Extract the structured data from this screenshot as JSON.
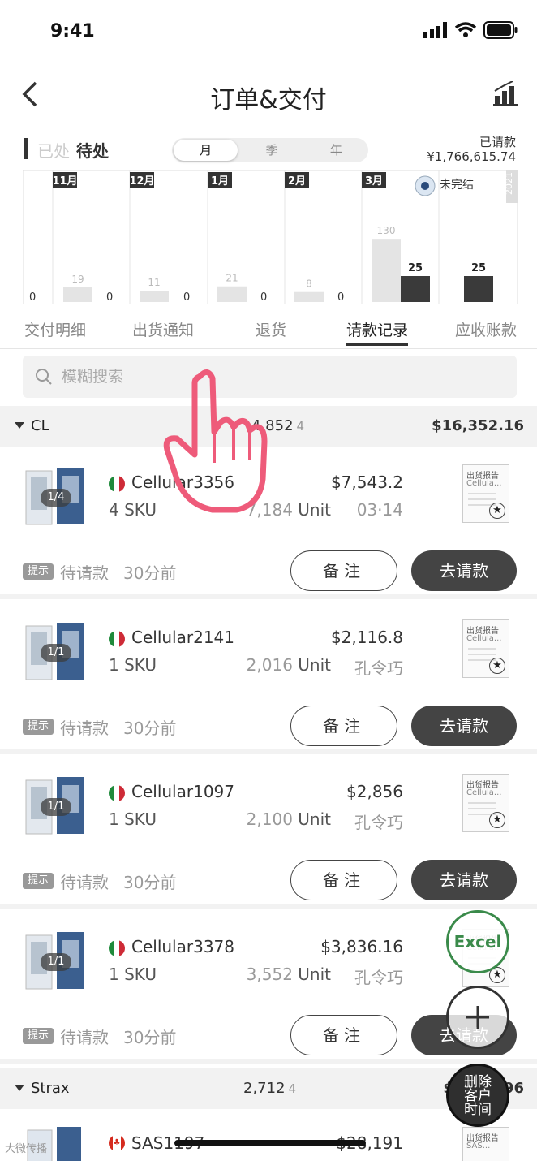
{
  "status": {
    "time": "9:41"
  },
  "header": {
    "title": "订单&交付",
    "back_icon": "chevron-left-icon",
    "chart_icon": "bar-chart-icon"
  },
  "toggle": {
    "done": "已处",
    "pending": "待处"
  },
  "period": {
    "options": [
      "月",
      "季",
      "年"
    ],
    "selected": "月"
  },
  "requested": {
    "label": "已请款",
    "amount": "¥1,766,615.74"
  },
  "chart_data": {
    "type": "bar",
    "year_label": "2021",
    "legend": "未完结",
    "categories": [
      "11月",
      "12月",
      "1月",
      "2月",
      "3月"
    ],
    "series": [
      {
        "name": "done",
        "values": [
          0,
          19,
          11,
          21,
          8,
          130
        ]
      },
      {
        "name": "pending",
        "values": [
          0,
          0,
          0,
          0,
          25,
          25
        ]
      }
    ],
    "value_labels": [
      "0",
      "19",
      "0",
      "11",
      "0",
      "21",
      "0",
      "8",
      "0",
      "130",
      "25",
      "25"
    ]
  },
  "tabs": [
    {
      "label": "交付明细"
    },
    {
      "label": "出货通知"
    },
    {
      "label": "退货"
    },
    {
      "label": "请款记录"
    },
    {
      "label": "应收账款"
    }
  ],
  "search": {
    "placeholder": "模糊搜索"
  },
  "groups": [
    {
      "name": "CL",
      "units": "4,852",
      "count": "4",
      "total": "$16,352.16"
    },
    {
      "name": "Strax",
      "units": "2,712",
      "count": "4",
      "total": "$",
      "total_suffix": "96"
    }
  ],
  "orders": [
    {
      "badge": "1/4",
      "name": "Cellular3356",
      "amount": "$7,543.2",
      "sku": "4 SKU",
      "units": "7,184",
      "unit_label": "Unit",
      "meta": "03·14",
      "report_title": "出货报告",
      "report_sub": "Cellula..."
    },
    {
      "badge": "1/1",
      "name": "Cellular2141",
      "amount": "$2,116.8",
      "sku": "1 SKU",
      "units": "2,016",
      "unit_label": "Unit",
      "meta": "孔令巧",
      "report_title": "出货报告",
      "report_sub": "Cellula..."
    },
    {
      "badge": "1/1",
      "name": "Cellular1097",
      "amount": "$2,856",
      "sku": "1 SKU",
      "units": "2,100",
      "unit_label": "Unit",
      "meta": "孔令巧",
      "report_title": "出货报告",
      "report_sub": "Cellula..."
    },
    {
      "badge": "1/1",
      "name": "Cellular3378",
      "amount": "$3,836.16",
      "sku": "1 SKU",
      "units": "3,552",
      "unit_label": "Unit",
      "meta": "孔令巧",
      "report_title": "出货报告",
      "report_sub": "Cellula..."
    }
  ],
  "last_order": {
    "name": "SAS1197",
    "amount": "$28,191",
    "report_title": "出货报告",
    "report_sub": "SAS..."
  },
  "card_common": {
    "tip": "提示",
    "status": "待请款",
    "time": "30分前",
    "note": "备注",
    "pay": "去请款"
  },
  "fab": {
    "excel": "Excel",
    "delete": [
      "删除",
      "客户",
      "时间"
    ]
  },
  "watermark": "大微传播"
}
